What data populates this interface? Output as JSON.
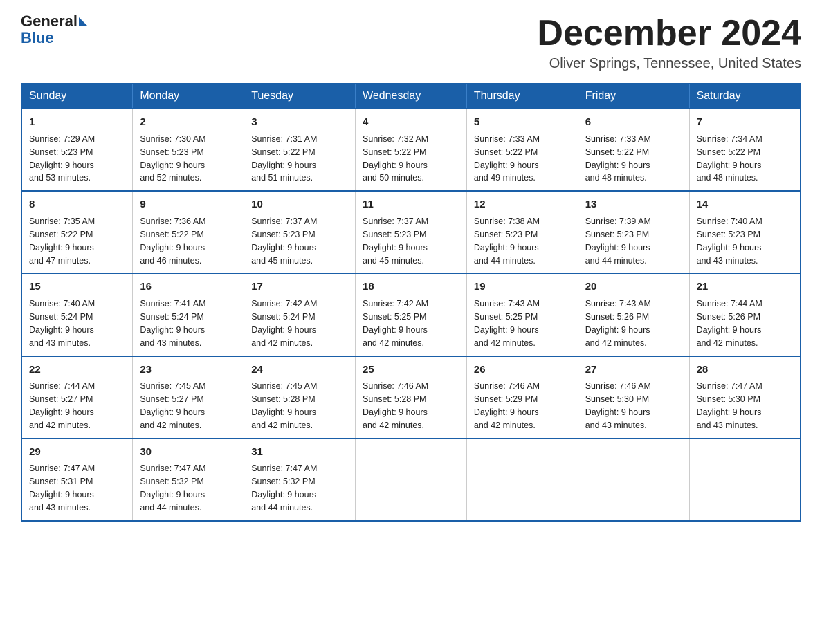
{
  "logo": {
    "general": "General",
    "blue": "Blue"
  },
  "header": {
    "month": "December 2024",
    "location": "Oliver Springs, Tennessee, United States"
  },
  "weekdays": [
    "Sunday",
    "Monday",
    "Tuesday",
    "Wednesday",
    "Thursday",
    "Friday",
    "Saturday"
  ],
  "weeks": [
    [
      {
        "day": "1",
        "sunrise": "7:29 AM",
        "sunset": "5:23 PM",
        "daylight": "9 hours and 53 minutes."
      },
      {
        "day": "2",
        "sunrise": "7:30 AM",
        "sunset": "5:23 PM",
        "daylight": "9 hours and 52 minutes."
      },
      {
        "day": "3",
        "sunrise": "7:31 AM",
        "sunset": "5:22 PM",
        "daylight": "9 hours and 51 minutes."
      },
      {
        "day": "4",
        "sunrise": "7:32 AM",
        "sunset": "5:22 PM",
        "daylight": "9 hours and 50 minutes."
      },
      {
        "day": "5",
        "sunrise": "7:33 AM",
        "sunset": "5:22 PM",
        "daylight": "9 hours and 49 minutes."
      },
      {
        "day": "6",
        "sunrise": "7:33 AM",
        "sunset": "5:22 PM",
        "daylight": "9 hours and 48 minutes."
      },
      {
        "day": "7",
        "sunrise": "7:34 AM",
        "sunset": "5:22 PM",
        "daylight": "9 hours and 48 minutes."
      }
    ],
    [
      {
        "day": "8",
        "sunrise": "7:35 AM",
        "sunset": "5:22 PM",
        "daylight": "9 hours and 47 minutes."
      },
      {
        "day": "9",
        "sunrise": "7:36 AM",
        "sunset": "5:22 PM",
        "daylight": "9 hours and 46 minutes."
      },
      {
        "day": "10",
        "sunrise": "7:37 AM",
        "sunset": "5:23 PM",
        "daylight": "9 hours and 45 minutes."
      },
      {
        "day": "11",
        "sunrise": "7:37 AM",
        "sunset": "5:23 PM",
        "daylight": "9 hours and 45 minutes."
      },
      {
        "day": "12",
        "sunrise": "7:38 AM",
        "sunset": "5:23 PM",
        "daylight": "9 hours and 44 minutes."
      },
      {
        "day": "13",
        "sunrise": "7:39 AM",
        "sunset": "5:23 PM",
        "daylight": "9 hours and 44 minutes."
      },
      {
        "day": "14",
        "sunrise": "7:40 AM",
        "sunset": "5:23 PM",
        "daylight": "9 hours and 43 minutes."
      }
    ],
    [
      {
        "day": "15",
        "sunrise": "7:40 AM",
        "sunset": "5:24 PM",
        "daylight": "9 hours and 43 minutes."
      },
      {
        "day": "16",
        "sunrise": "7:41 AM",
        "sunset": "5:24 PM",
        "daylight": "9 hours and 43 minutes."
      },
      {
        "day": "17",
        "sunrise": "7:42 AM",
        "sunset": "5:24 PM",
        "daylight": "9 hours and 42 minutes."
      },
      {
        "day": "18",
        "sunrise": "7:42 AM",
        "sunset": "5:25 PM",
        "daylight": "9 hours and 42 minutes."
      },
      {
        "day": "19",
        "sunrise": "7:43 AM",
        "sunset": "5:25 PM",
        "daylight": "9 hours and 42 minutes."
      },
      {
        "day": "20",
        "sunrise": "7:43 AM",
        "sunset": "5:26 PM",
        "daylight": "9 hours and 42 minutes."
      },
      {
        "day": "21",
        "sunrise": "7:44 AM",
        "sunset": "5:26 PM",
        "daylight": "9 hours and 42 minutes."
      }
    ],
    [
      {
        "day": "22",
        "sunrise": "7:44 AM",
        "sunset": "5:27 PM",
        "daylight": "9 hours and 42 minutes."
      },
      {
        "day": "23",
        "sunrise": "7:45 AM",
        "sunset": "5:27 PM",
        "daylight": "9 hours and 42 minutes."
      },
      {
        "day": "24",
        "sunrise": "7:45 AM",
        "sunset": "5:28 PM",
        "daylight": "9 hours and 42 minutes."
      },
      {
        "day": "25",
        "sunrise": "7:46 AM",
        "sunset": "5:28 PM",
        "daylight": "9 hours and 42 minutes."
      },
      {
        "day": "26",
        "sunrise": "7:46 AM",
        "sunset": "5:29 PM",
        "daylight": "9 hours and 42 minutes."
      },
      {
        "day": "27",
        "sunrise": "7:46 AM",
        "sunset": "5:30 PM",
        "daylight": "9 hours and 43 minutes."
      },
      {
        "day": "28",
        "sunrise": "7:47 AM",
        "sunset": "5:30 PM",
        "daylight": "9 hours and 43 minutes."
      }
    ],
    [
      {
        "day": "29",
        "sunrise": "7:47 AM",
        "sunset": "5:31 PM",
        "daylight": "9 hours and 43 minutes."
      },
      {
        "day": "30",
        "sunrise": "7:47 AM",
        "sunset": "5:32 PM",
        "daylight": "9 hours and 44 minutes."
      },
      {
        "day": "31",
        "sunrise": "7:47 AM",
        "sunset": "5:32 PM",
        "daylight": "9 hours and 44 minutes."
      },
      null,
      null,
      null,
      null
    ]
  ],
  "labels": {
    "sunrise": "Sunrise:",
    "sunset": "Sunset:",
    "daylight": "Daylight:"
  }
}
